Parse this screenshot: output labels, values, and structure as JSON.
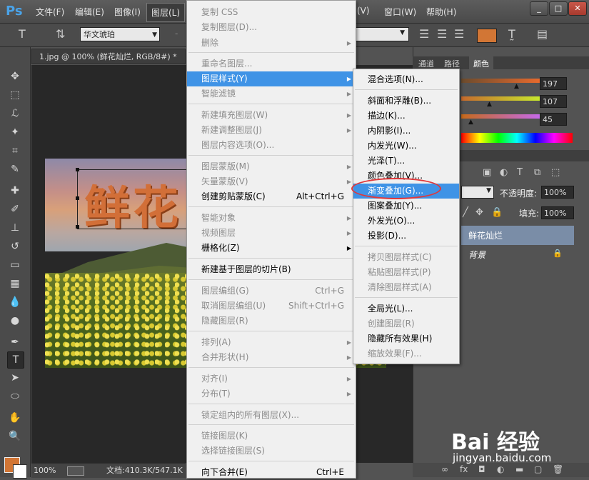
{
  "app": {
    "logo": "Ps",
    "menubar": [
      "文件(F)",
      "编辑(E)",
      "图像(I)",
      "图层(L)",
      "(V)",
      "窗口(W)",
      "帮助(H)"
    ],
    "window_buttons": [
      "_",
      "□",
      "✕"
    ]
  },
  "options_bar": {
    "font_family": "华文琥珀",
    "font_style": "-"
  },
  "document": {
    "tab_title": "1.jpg @ 100% (鲜花灿烂, RGB/8#) *",
    "overlay_text": "鲜花",
    "status_zoom": "100%",
    "status_doc": "文档:410.3K/547.1K"
  },
  "right_panel": {
    "tabs": [
      "通道",
      "路径",
      "颜色"
    ],
    "color_values": [
      "197",
      "107",
      "45"
    ],
    "opacity_label": "不透明度:",
    "opacity_value": "100%",
    "fill_label": "填充:",
    "fill_value": "100%",
    "layers": [
      {
        "name": "鲜花灿烂"
      },
      {
        "name": "背景"
      }
    ]
  },
  "layer_menu": {
    "items": [
      {
        "label": "复制 CSS",
        "disabled": true
      },
      {
        "label": "复制图层(D)...",
        "disabled": true
      },
      {
        "label": "删除",
        "disabled": true,
        "submenu": true
      },
      {
        "label": "重命名图层...",
        "disabled": true
      },
      {
        "label": "图层样式(Y)",
        "disabled": false,
        "submenu": true,
        "highlighted": true
      },
      {
        "label": "智能滤镜",
        "disabled": true,
        "submenu": true
      },
      {
        "label": "新建填充图层(W)",
        "disabled": true,
        "submenu": true
      },
      {
        "label": "新建调整图层(J)",
        "disabled": true,
        "submenu": true
      },
      {
        "label": "图层内容选项(O)...",
        "disabled": true
      },
      {
        "label": "图层蒙版(M)",
        "disabled": true,
        "submenu": true
      },
      {
        "label": "矢量蒙版(V)",
        "disabled": true,
        "submenu": true
      },
      {
        "label": "创建剪贴蒙版(C)",
        "shortcut": "Alt+Ctrl+G",
        "disabled": false
      },
      {
        "label": "智能对象",
        "disabled": true,
        "submenu": true
      },
      {
        "label": "视频图层",
        "disabled": true,
        "submenu": true
      },
      {
        "label": "栅格化(Z)",
        "disabled": false,
        "submenu": true
      },
      {
        "label": "新建基于图层的切片(B)",
        "disabled": false
      },
      {
        "label": "图层编组(G)",
        "shortcut": "Ctrl+G",
        "disabled": true
      },
      {
        "label": "取消图层编组(U)",
        "shortcut": "Shift+Ctrl+G",
        "disabled": true
      },
      {
        "label": "隐藏图层(R)",
        "disabled": true
      },
      {
        "label": "排列(A)",
        "disabled": true,
        "submenu": true
      },
      {
        "label": "合并形状(H)",
        "disabled": true,
        "submenu": true
      },
      {
        "label": "对齐(I)",
        "disabled": true,
        "submenu": true
      },
      {
        "label": "分布(T)",
        "disabled": true,
        "submenu": true
      },
      {
        "label": "锁定组内的所有图层(X)...",
        "disabled": true
      },
      {
        "label": "链接图层(K)",
        "disabled": true
      },
      {
        "label": "选择链接图层(S)",
        "disabled": true
      },
      {
        "label": "向下合并(E)",
        "shortcut": "Ctrl+E",
        "disabled": false
      }
    ]
  },
  "style_submenu": {
    "items": [
      {
        "label": "混合选项(N)...",
        "disabled": false
      },
      {
        "label": "斜面和浮雕(B)...",
        "disabled": false
      },
      {
        "label": "描边(K)...",
        "disabled": false
      },
      {
        "label": "内阴影(I)...",
        "disabled": false
      },
      {
        "label": "内发光(W)...",
        "disabled": false
      },
      {
        "label": "光泽(T)...",
        "disabled": false
      },
      {
        "label": "颜色叠加(V)...",
        "disabled": false
      },
      {
        "label": "渐变叠加(G)...",
        "disabled": false,
        "highlighted": true
      },
      {
        "label": "图案叠加(Y)...",
        "disabled": false
      },
      {
        "label": "外发光(O)...",
        "disabled": false
      },
      {
        "label": "投影(D)...",
        "disabled": false
      },
      {
        "label": "拷贝图层样式(C)",
        "disabled": true
      },
      {
        "label": "粘贴图层样式(P)",
        "disabled": true
      },
      {
        "label": "清除图层样式(A)",
        "disabled": true
      },
      {
        "label": "全局光(L)...",
        "disabled": false
      },
      {
        "label": "创建图层(R)",
        "disabled": true
      },
      {
        "label": "隐藏所有效果(H)",
        "disabled": false
      },
      {
        "label": "缩放效果(F)...",
        "disabled": true
      }
    ]
  },
  "watermark": {
    "text": "Bai 经验",
    "url": "jingyan.baidu.com"
  },
  "colors": {
    "accent_highlight": "#3f93e6",
    "foreground_swatch": "#d27635",
    "annotation_ring": "#e0383b"
  }
}
